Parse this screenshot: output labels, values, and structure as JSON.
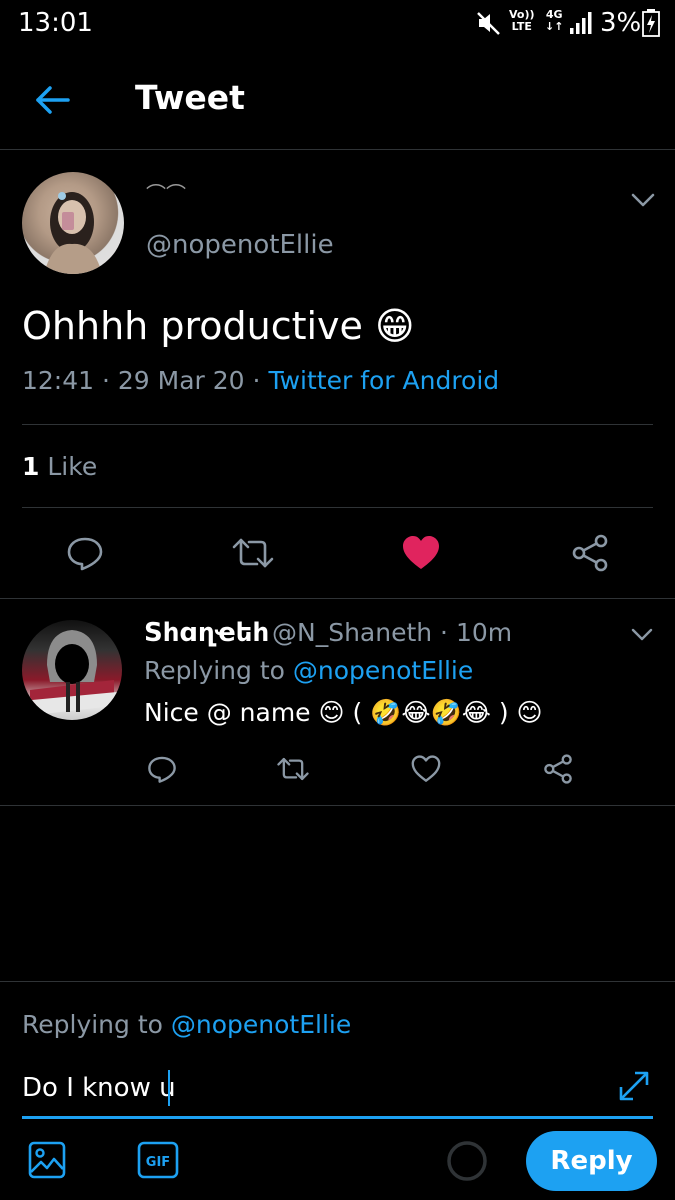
{
  "status_bar": {
    "time": "13:01",
    "volte_top": "Vo))",
    "volte_bottom": "LTE",
    "network_top": "4G",
    "network_bottom": "↓↑",
    "battery": "3%"
  },
  "header": {
    "title": "Tweet"
  },
  "tweet": {
    "display_name": "⌒⌒",
    "handle": "@nopenotEllie",
    "text": "Ohhhh productive 😁",
    "time": "12:41",
    "date": "29 Mar 20",
    "source": "Twitter for Android",
    "like_count": "1",
    "like_label": "Like"
  },
  "reply": {
    "name": "Sհɑղҽեհ",
    "handle_time": "@N_Shaneth · 10m",
    "replying_label": "Replying to",
    "replying_to": "@nopenotEllie",
    "text": "Nice @ name 😊 ( 🤣😂🤣😂 ) 😊"
  },
  "composer": {
    "replying_label": "Replying to",
    "replying_to": "@nopenotEllie",
    "value": "Do I know u",
    "gif_label": "GIF",
    "reply_button": "Reply"
  },
  "colors": {
    "accent": "#1da1f2",
    "like": "#e0245e",
    "muted": "#8b98a5",
    "divider": "#2f3336"
  }
}
